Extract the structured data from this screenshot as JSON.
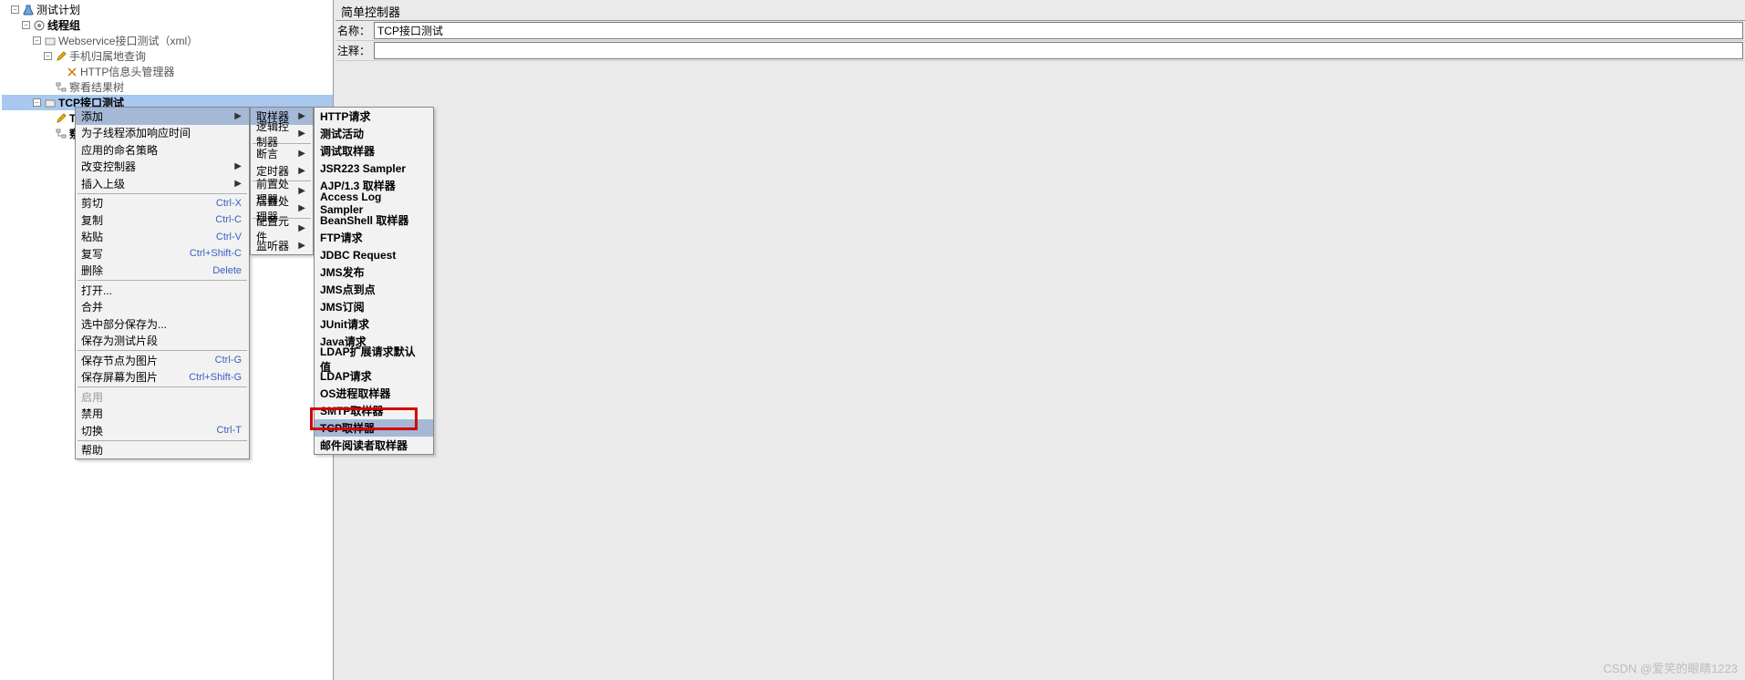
{
  "tree": {
    "root": "测试计划",
    "thread_group": "线程组",
    "webservice": "Webservice接口测试（xml）",
    "phone_query": "手机归属地查询",
    "http_header_mgr": "HTTP信息头管理器",
    "view_tree1": "察看结果树",
    "tcp_test": "TCP接口测试",
    "tcp_sampler": "TCP取样器",
    "view_tree2": "察看结果树"
  },
  "panel": {
    "title": "简单控制器",
    "name_label": "名称：",
    "name_value": "TCP接口测试",
    "comment_label": "注释："
  },
  "ctx1": {
    "add": "添加",
    "add_think_time": "为子线程添加响应时间",
    "naming_policy": "应用的命名策略",
    "change_controller": "改变控制器",
    "insert_parent": "插入上级",
    "cut": "剪切",
    "cut_sc": "Ctrl-X",
    "copy": "复制",
    "copy_sc": "Ctrl-C",
    "paste": "粘贴",
    "paste_sc": "Ctrl-V",
    "duplicate": "复写",
    "dup_sc": "Ctrl+Shift-C",
    "delete": "删除",
    "del_sc": "Delete",
    "open": "打开...",
    "merge": "合并",
    "save_sel": "选中部分保存为...",
    "save_frag": "保存为测试片段",
    "save_node_img": "保存节点为图片",
    "snim_sc": "Ctrl-G",
    "save_screen_img": "保存屏幕为图片",
    "ssim_sc": "Ctrl+Shift-G",
    "enable": "启用",
    "disable": "禁用",
    "toggle": "切换",
    "tog_sc": "Ctrl-T",
    "help": "帮助"
  },
  "ctx2": {
    "sampler": "取样器",
    "logic": "逻辑控制器",
    "assert": "断言",
    "timer": "定时器",
    "pre": "前置处理器",
    "post": "后置处理器",
    "config": "配置元件",
    "listener": "监听器"
  },
  "ctx3": {
    "http_req": "HTTP请求",
    "test_act": "测试活动",
    "debug": "调试取样器",
    "jsr223": "JSR223 Sampler",
    "ajp": "AJP/1.3 取样器",
    "access_log": "Access Log Sampler",
    "beanshell": "BeanShell 取样器",
    "ftp": "FTP请求",
    "jdbc": "JDBC Request",
    "jms_pub": "JMS发布",
    "jms_p2p": "JMS点到点",
    "jms_sub": "JMS订阅",
    "junit": "JUnit请求",
    "java": "Java请求",
    "ldap_ext": "LDAP扩展请求默认值",
    "ldap": "LDAP请求",
    "os_proc": "OS进程取样器",
    "smtp": "SMTP取样器",
    "tcp": "TCP取样器",
    "mail": "邮件阅读者取样器"
  },
  "watermark": "CSDN @爱笑的眼睛1223"
}
